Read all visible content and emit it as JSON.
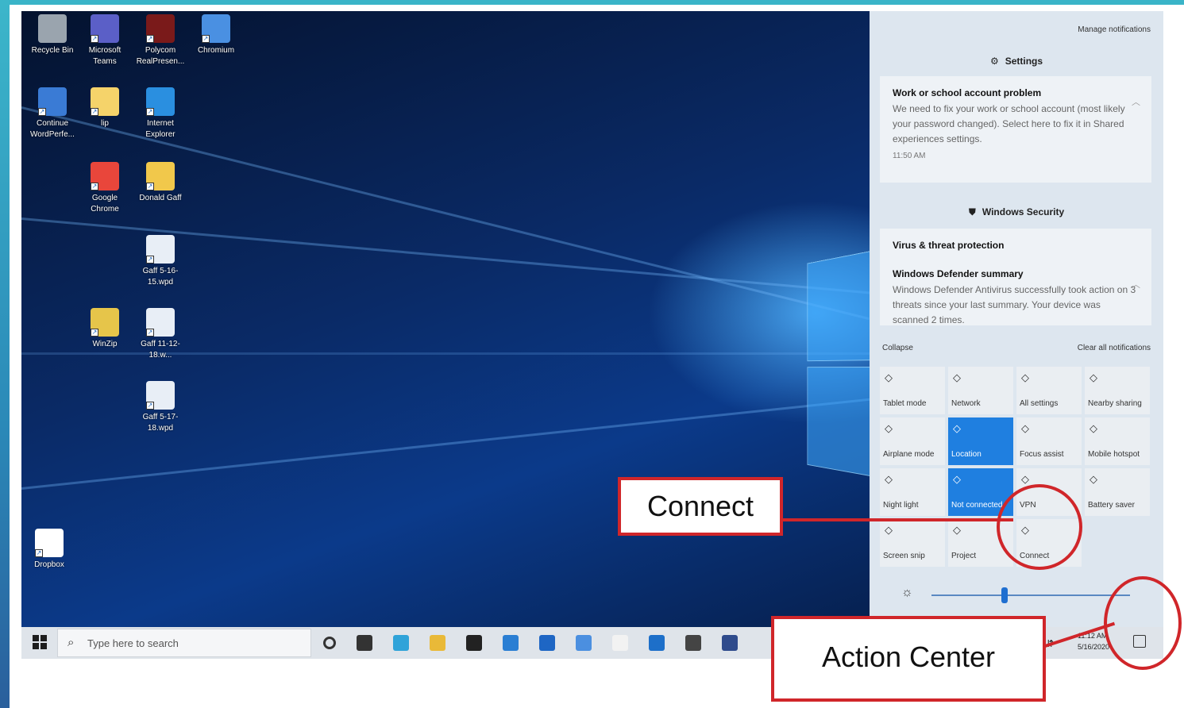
{
  "desktop": {
    "icons": [
      {
        "label": "Recycle Bin",
        "icon": "recycle-bin-icon",
        "color": "#9aa4ae"
      },
      {
        "label": "Microsoft Teams",
        "icon": "teams-icon",
        "color": "#5b5fc7"
      },
      {
        "label": "Polycom RealPresen...",
        "icon": "polycom-icon",
        "color": "#7a1a1a"
      },
      {
        "label": "Chromium",
        "icon": "chromium-icon",
        "color": "#4a90e2"
      },
      {
        "label": "Continue WordPerfe...",
        "icon": "wordperfect-icon",
        "color": "#3a7bd5"
      },
      {
        "label": "lip",
        "icon": "folder-icon",
        "color": "#f5d36a"
      },
      {
        "label": "Internet Explorer",
        "icon": "internet-explorer-icon",
        "color": "#2a8fe0"
      },
      {
        "label": "Google Chrome",
        "icon": "chrome-icon",
        "color": "#e9463b"
      },
      {
        "label": "Donald Gaff",
        "icon": "folder-icon",
        "color": "#f1c84b"
      },
      {
        "label": "Gaff 5-16-15.wpd",
        "icon": "wpd-file-icon",
        "color": "#e8eef6"
      },
      {
        "label": "WinZip",
        "icon": "winzip-icon",
        "color": "#e6c54a"
      },
      {
        "label": "Gaff 11-12-18.w...",
        "icon": "wpd-file-icon",
        "color": "#e8eef6"
      },
      {
        "label": "Gaff 5-17-18.wpd",
        "icon": "wpd-file-icon",
        "color": "#e8eef6"
      },
      {
        "label": "Dropbox",
        "icon": "dropbox-icon",
        "color": "#ffffff"
      }
    ]
  },
  "taskbar": {
    "search_placeholder": "Type here to search",
    "search_icon": "search-icon",
    "apps": [
      {
        "name": "task-view-icon",
        "color": "#333333"
      },
      {
        "name": "edge-icon",
        "color": "#2fa3d9"
      },
      {
        "name": "file-explorer-icon",
        "color": "#e9b938"
      },
      {
        "name": "store-icon",
        "color": "#222222"
      },
      {
        "name": "mail-icon",
        "color": "#2a7ed3"
      },
      {
        "name": "outlook-icon",
        "color": "#1e66c4"
      },
      {
        "name": "teams-taskbar-icon",
        "color": "#4b8fe0"
      },
      {
        "name": "document-icon",
        "color": "#f2f2f2"
      },
      {
        "name": "photos-icon",
        "color": "#1d6fc9"
      },
      {
        "name": "calculator-icon",
        "color": "#444444"
      },
      {
        "name": "chromium-taskbar-icon",
        "color": "#2f4b8c"
      }
    ],
    "clock_time": "11:12 AM",
    "clock_date": "5/16/2020"
  },
  "action_center": {
    "manage_notifications": "Manage notifications",
    "settings_header": "Settings",
    "settings_icon": "gear-icon",
    "notification1": {
      "title": "Work or school account problem",
      "body": "We need to fix your work or school account (most likely your password changed). Select here to fix it in Shared experiences settings.",
      "time": "11:50 AM"
    },
    "security_header": "Windows Security",
    "security_icon": "shield-icon",
    "notification2": {
      "title": "Virus & threat protection",
      "subtitle": "Windows Defender summary",
      "body": "Windows Defender Antivirus successfully took action on 3 threats since your last summary. Your device was scanned 2 times."
    },
    "collapse": "Collapse",
    "clear_all": "Clear all notifications",
    "tiles": [
      {
        "label": "Tablet mode",
        "icon": "tablet-icon",
        "on": false
      },
      {
        "label": "Network",
        "icon": "network-icon",
        "on": false
      },
      {
        "label": "All settings",
        "icon": "settings-icon",
        "on": false
      },
      {
        "label": "Nearby sharing",
        "icon": "share-icon",
        "on": false
      },
      {
        "label": "Airplane mode",
        "icon": "airplane-icon",
        "on": false
      },
      {
        "label": "Location",
        "icon": "location-icon",
        "on": true
      },
      {
        "label": "Focus assist",
        "icon": "moon-icon",
        "on": false
      },
      {
        "label": "Mobile hotspot",
        "icon": "hotspot-icon",
        "on": false
      },
      {
        "label": "Night light",
        "icon": "night-light-icon",
        "on": false
      },
      {
        "label": "Not connected",
        "icon": "bluetooth-icon",
        "on": true
      },
      {
        "label": "VPN",
        "icon": "vpn-icon",
        "on": false
      },
      {
        "label": "Battery saver",
        "icon": "battery-saver-icon",
        "on": false
      },
      {
        "label": "Screen snip",
        "icon": "screen-snip-icon",
        "on": false
      },
      {
        "label": "Project",
        "icon": "project-icon",
        "on": false
      },
      {
        "label": "Connect",
        "icon": "connect-icon",
        "on": false
      }
    ],
    "brightness_level": 0.35,
    "brightness_icon": "sun-icon"
  },
  "callouts": {
    "connect": "Connect",
    "action_center": "Action Center"
  },
  "colors": {
    "callout_red": "#d0262a",
    "tile_active": "#1f7fe0"
  }
}
